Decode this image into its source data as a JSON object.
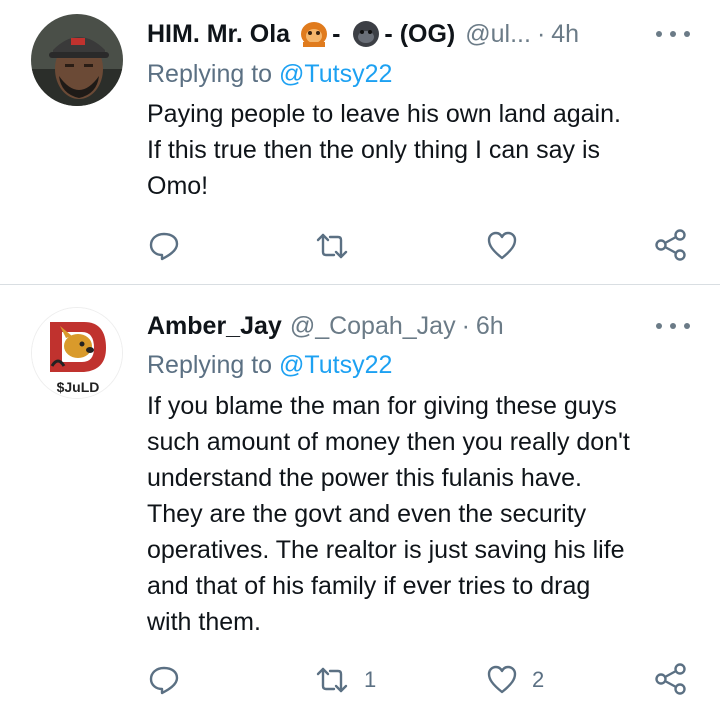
{
  "tweets": [
    {
      "name": "HIM. Mr. Ola",
      "separator_1": "-",
      "separator_2": "- (OG)",
      "handle": "@ul...",
      "dot": "·",
      "time": "4h",
      "reply_prefix": "Replying to",
      "reply_to": "@Tutsy22",
      "body_lines": [
        "Paying people to leave his own land again.",
        "If this true then the only thing I can say is",
        "Omo!"
      ],
      "retweets": "",
      "likes": "",
      "icons": [
        "orangutan-emoji",
        "gorilla-emoji"
      ]
    },
    {
      "name": "Amber_Jay",
      "handle": "@_Copah_Jay",
      "dot": "·",
      "time": "6h",
      "reply_prefix": "Replying to",
      "reply_to": "@Tutsy22",
      "avatar_text": "$JuLD",
      "body_lines": [
        "If you blame the man for giving these guys",
        "such amount of money then you really don't",
        "understand the power this fulanis have.",
        "They are the govt and even the security",
        "operatives. The realtor is just saving his life",
        "and that of his family if ever tries to drag",
        "with them."
      ],
      "retweets": "1",
      "likes": "2"
    }
  ],
  "colors": {
    "text": "#0f1419",
    "secondary": "#5b7083",
    "link": "#1da1f2",
    "divider": "#d9dee2"
  }
}
